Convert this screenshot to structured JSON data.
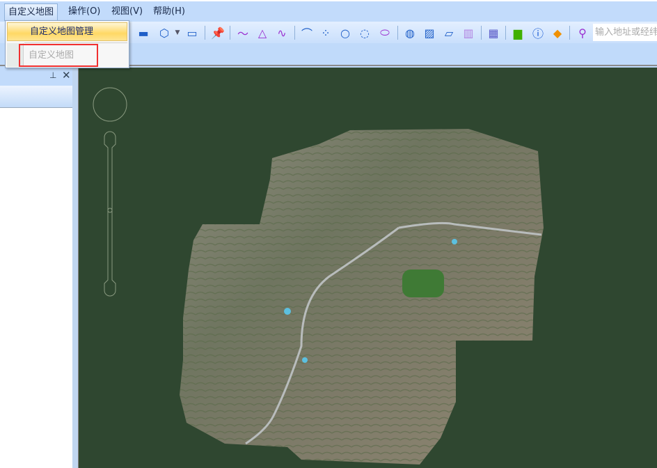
{
  "menubar": {
    "items": [
      "自定义地图",
      "操作(O)",
      "视图(V)",
      "帮助(H)"
    ]
  },
  "dropdown": {
    "items": [
      "自定义地图管理",
      "自定义地图"
    ],
    "highlighted": "自定义地图管理",
    "disabled": "自定义地图"
  },
  "toolbar": {
    "icons": [
      "ruler-icon",
      "cube-icon",
      "camera-icon",
      "pushpin-icon",
      "polyline-icon",
      "angle-icon",
      "curve-icon",
      "arc-icon",
      "points-icon",
      "circle-icon",
      "arc-circle-icon",
      "ellipse-icon",
      "hatched-circle-icon",
      "hatched-square-icon",
      "hatched-polygon-icon",
      "columns-icon",
      "building-icon",
      "chat-icon",
      "info-icon",
      "vip-diamond-icon",
      "search-icon"
    ],
    "search_placeholder": "输入地址或经纬度"
  },
  "panel": {
    "pin_icon": "pin-icon",
    "close_icon": "close-icon"
  },
  "colors": {
    "map_bg": "#2f4730",
    "highlight_box": "#f03030",
    "menu_hover": "#ffd865"
  }
}
